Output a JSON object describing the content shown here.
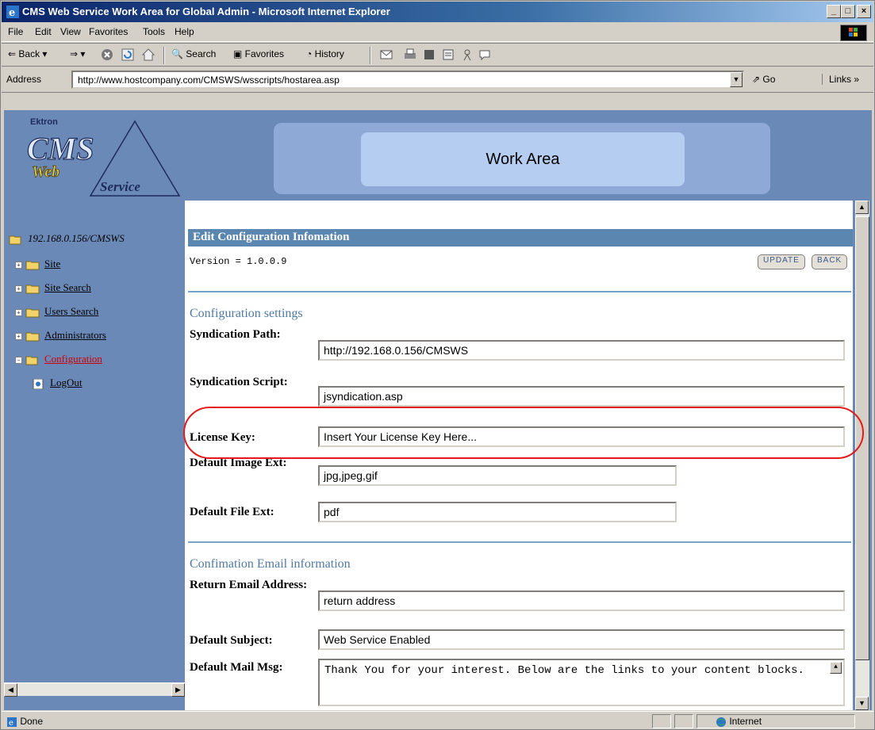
{
  "window": {
    "title": "CMS Web Service Work Area for Global Admin - Microsoft Internet Explorer",
    "controls": [
      "_",
      "□",
      "×"
    ]
  },
  "menu": [
    "File",
    "Edit",
    "View",
    "Favorites",
    "Tools",
    "Help"
  ],
  "toolbar": {
    "back": "Back",
    "search": "Search",
    "favorites": "Favorites",
    "history": "History"
  },
  "address": {
    "label": "Address",
    "url": "http://www.hostcompany.com/CMSWS/wsscripts/hostarea.asp",
    "go": "Go",
    "links": "Links"
  },
  "banner": {
    "logo_top": "Ektron",
    "logo_main": "CMS",
    "logo_web": "Web",
    "logo_service": "Service",
    "work_area": "Work Area"
  },
  "tree": {
    "root": "192.168.0.156/CMSWS",
    "items": [
      {
        "label": "Site",
        "active": false
      },
      {
        "label": "Site Search",
        "active": false
      },
      {
        "label": "Users Search",
        "active": false
      },
      {
        "label": "Administrators",
        "active": false
      },
      {
        "label": "Configuration",
        "active": true
      },
      {
        "label": "LogOut",
        "active": false
      }
    ]
  },
  "main": {
    "header": "Edit Configuration Infomation",
    "version": "Version = 1.0.0.9",
    "update_button": "UPDATE",
    "back_button": "BACK",
    "config_section": "Configuration settings",
    "fields": {
      "syndication_path": {
        "label": "Syndication Path:",
        "value": "http://192.168.0.156/CMSWS"
      },
      "syndication_script": {
        "label": "Syndication Script:",
        "value": "jsyndication.asp"
      },
      "license_key": {
        "label": "License Key:",
        "value": "Insert Your License Key Here..."
      },
      "default_image_ext": {
        "label": "Default Image Ext:",
        "value": "jpg,jpeg,gif"
      },
      "default_file_ext": {
        "label": "Default File Ext:",
        "value": "pdf"
      }
    },
    "email_section": "Confimation Email information",
    "email_fields": {
      "return_email": {
        "label": "Return Email Address:",
        "value": "return address"
      },
      "default_subject": {
        "label": "Default Subject:",
        "value": "Web Service Enabled"
      },
      "default_mail_msg": {
        "label": "Default Mail Msg:",
        "value": "Thank You for your interest. Below are the links to your content blocks."
      }
    }
  },
  "status": {
    "text": "Done",
    "zone": "Internet"
  }
}
